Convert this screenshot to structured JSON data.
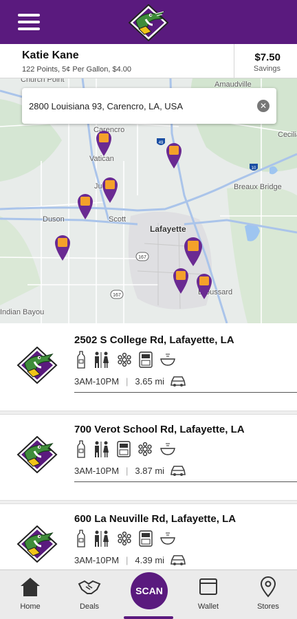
{
  "header": {
    "menu_icon": "hamburger-menu-icon",
    "logo": "gator-logo"
  },
  "account": {
    "name": "Katie Kane",
    "details": "122 Points, 5¢ Per Gallon, $4.00",
    "savings_value": "$7.50",
    "savings_label": "Savings"
  },
  "search": {
    "value": "2800 Louisiana 93, Carencro, LA, USA",
    "clear_icon": "clear-icon"
  },
  "map": {
    "labels": {
      "church_point": "Church Point",
      "amaudville": "Amaudville",
      "carencro": "Carencro",
      "vatican": "Vatican",
      "judice": "Judice",
      "breaux_bridge": "Breaux Bridge",
      "duson": "Duson",
      "scott": "Scott",
      "lafayette": "Lafayette",
      "broussard": "Broussard",
      "indian_bayou": "Indian Bayou",
      "cecilia": "Cecilia"
    },
    "shields": {
      "i49": "49",
      "i10": "10",
      "r167": "167",
      "r167b": "167"
    }
  },
  "stores": [
    {
      "address": "2502 S College Rd, Lafayette, LA",
      "hours": "3AM-10PM",
      "distance": "3.65 mi",
      "amenities": [
        "water-bottle-icon",
        "restroom-icon",
        "ice-icon",
        "cash-machine-icon",
        "food-bowl-icon"
      ]
    },
    {
      "address": "700 Verot School Rd, Lafayette, LA",
      "hours": "3AM-10PM",
      "distance": "3.87 mi",
      "amenities": [
        "water-bottle-icon",
        "restroom-icon",
        "cash-machine-icon",
        "ice-icon",
        "food-bowl-icon"
      ]
    },
    {
      "address": "600 La Neuville Rd, Lafayette, LA",
      "hours": "3AM-10PM",
      "distance": "4.39 mi",
      "amenities": [
        "water-bottle-icon",
        "restroom-icon",
        "ice-icon",
        "cash-machine-icon",
        "food-bowl-icon"
      ]
    }
  ],
  "nav": {
    "home": "Home",
    "deals": "Deals",
    "scan": "SCAN",
    "wallet": "Wallet",
    "stores": "Stores"
  },
  "colors": {
    "brand_purple": "#5a1a7e",
    "gator_green": "#3f8d3a",
    "road_blue": "#aac4ea"
  }
}
